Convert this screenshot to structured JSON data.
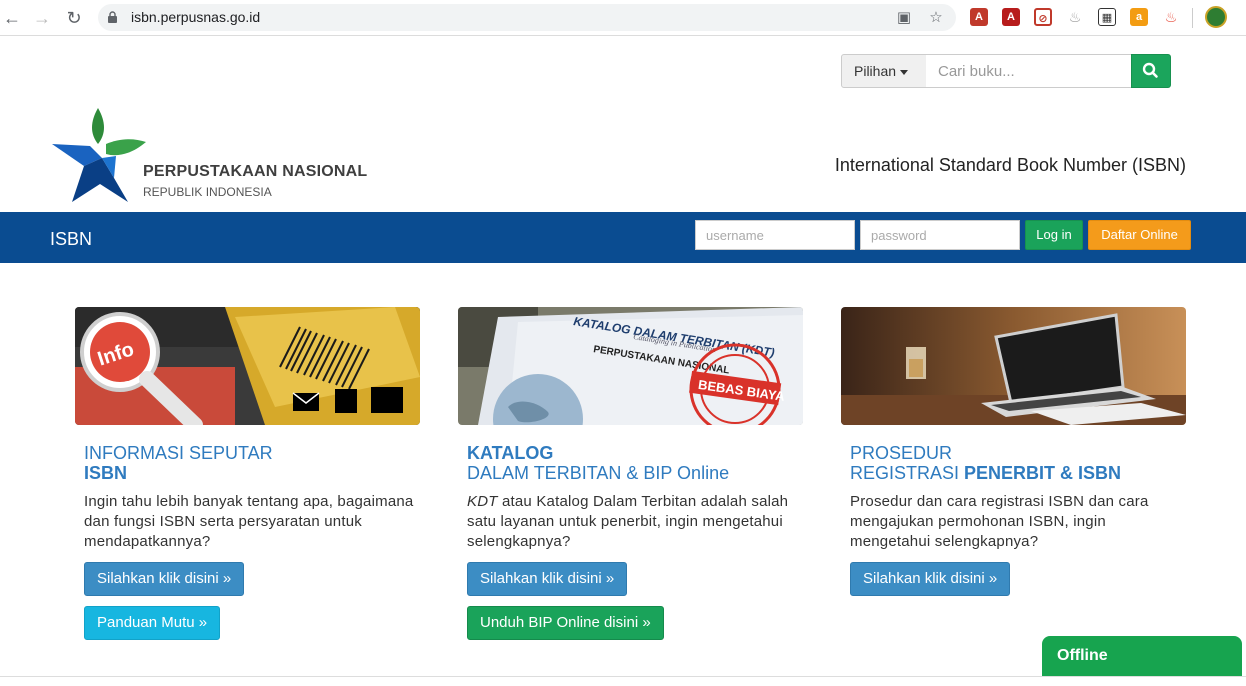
{
  "browser": {
    "url": "isbn.perpusnas.go.id"
  },
  "search": {
    "dropdown_label": "Pilihan",
    "placeholder": "Cari buku..."
  },
  "logo": {
    "title": "PERPUSTAKAAN NASIONAL",
    "subtitle": "REPUBLIK INDONESIA"
  },
  "header": {
    "tagline": "International Standard Book Number (ISBN)"
  },
  "navbar": {
    "brand": "ISBN",
    "username_placeholder": "username",
    "password_placeholder": "password",
    "login_label": "Log in",
    "register_label": "Daftar Online"
  },
  "cards": [
    {
      "title_line1": "INFORMASI SEPUTAR",
      "title_line2": "ISBN",
      "text": "Ingin tahu lebih banyak tentang apa, bagaimana dan fungsi ISBN serta persyaratan untuk mendapatkannya?",
      "button1": "Silahkan klik disini »",
      "button2": "Panduan Mutu »",
      "image_badge": "Info"
    },
    {
      "title_line1": "KATALOG",
      "title_line2": "DALAM TERBITAN & BIP Online",
      "text_em": "KDT",
      "text": " atau Katalog Dalam Terbitan adalah salah satu layanan untuk penerbit, ingin mengetahui selengkapnya?",
      "button1": "Silahkan klik disini »",
      "button2": "Unduh BIP Online disini »",
      "image_heading": "KATALOG DALAM TERBITAN (KDT)",
      "image_subheading": "Cataloging in Publication",
      "image_org": "PERPUSTAKAAN NASIONAL",
      "image_stamp": "BEBAS BIAYA"
    },
    {
      "title_line1": "PROSEDUR",
      "title_line2_plain": "REGISTRASI ",
      "title_line2_bold": "PENERBIT & ISBN",
      "text": "Prosedur dan cara registrasi ISBN dan cara mengajukan permohonan ISBN, ingin mengetahui selengkapnya?",
      "button1": "Silahkan klik disini »"
    }
  ],
  "chat": {
    "status": "Offline"
  }
}
